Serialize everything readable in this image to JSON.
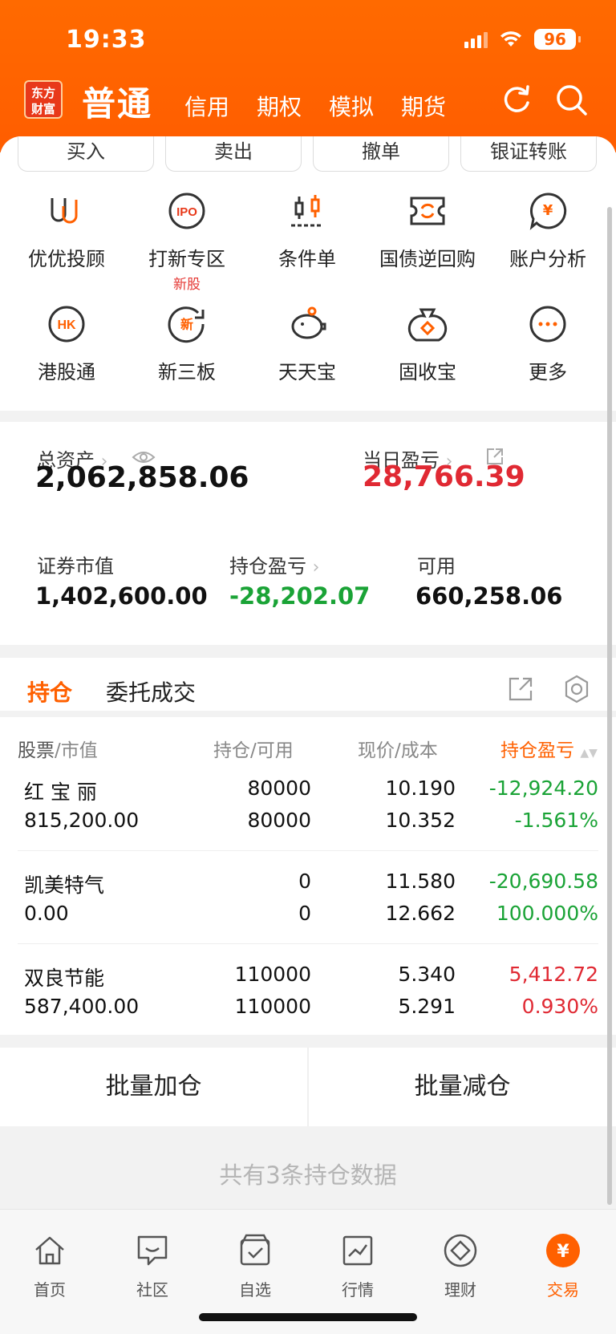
{
  "status": {
    "time": "19:33",
    "battery": "96"
  },
  "header": {
    "logo": "东方财富",
    "active_tab": "普通",
    "tabs": [
      "信用",
      "期权",
      "模拟",
      "期货"
    ]
  },
  "quick_buttons": [
    "买入",
    "卖出",
    "撤单",
    "银证转账"
  ],
  "functions": [
    {
      "label": "优优投顾",
      "icon": "uu-advisor-icon"
    },
    {
      "label": "打新专区",
      "sub": "新股",
      "icon": "ipo-icon"
    },
    {
      "label": "条件单",
      "icon": "conditional-order-icon"
    },
    {
      "label": "国债逆回购",
      "icon": "reverse-repo-icon"
    },
    {
      "label": "账户分析",
      "icon": "account-analysis-icon"
    },
    {
      "label": "港股通",
      "icon": "hk-connect-icon"
    },
    {
      "label": "新三板",
      "icon": "neeq-icon"
    },
    {
      "label": "天天宝",
      "icon": "piggy-bank-icon"
    },
    {
      "label": "固收宝",
      "icon": "money-bag-icon"
    },
    {
      "label": "更多",
      "icon": "more-icon"
    }
  ],
  "assets": {
    "total_label": "总资产",
    "total_value": "2,062,858.06",
    "daily_label": "当日盈亏",
    "daily_value": "28,766.39",
    "market_label": "证券市值",
    "market_value": "1,402,600.00",
    "position_pl_label": "持仓盈亏",
    "position_pl_value": "-28,202.07",
    "available_label": "可用",
    "available_value": "660,258.06"
  },
  "holdings": {
    "tab_active": "持仓",
    "tab_other": "委托成交",
    "headers": {
      "stock": "股票",
      "value": "市值",
      "position": "持仓",
      "available": "可用",
      "price": "现价",
      "cost": "成本",
      "pl": "持仓盈亏"
    },
    "rows": [
      {
        "name": "红 宝 丽",
        "value": "815,200.00",
        "position": "80000",
        "available": "80000",
        "price": "10.190",
        "cost": "10.352",
        "pl": "-12,924.20",
        "pl_pct": "-1.561%",
        "color": "#1aa336"
      },
      {
        "name": "凯美特气",
        "value": "0.00",
        "position": "0",
        "available": "0",
        "price": "11.580",
        "cost": "12.662",
        "pl": "-20,690.58",
        "pl_pct": "100.000%",
        "color": "#1aa336"
      },
      {
        "name": "双良节能",
        "value": "587,400.00",
        "position": "110000",
        "available": "110000",
        "price": "5.340",
        "cost": "5.291",
        "pl": "5,412.72",
        "pl_pct": "0.930%",
        "color": "#e02933"
      }
    ]
  },
  "batch": {
    "add": "批量加仓",
    "reduce": "批量减仓"
  },
  "footnote": "共有3条持仓数据",
  "tabbar": [
    {
      "label": "首页",
      "icon": "home-icon"
    },
    {
      "label": "社区",
      "icon": "community-icon"
    },
    {
      "label": "自选",
      "icon": "watchlist-icon"
    },
    {
      "label": "行情",
      "icon": "market-icon"
    },
    {
      "label": "理财",
      "icon": "wealth-icon"
    },
    {
      "label": "交易",
      "icon": "trade-icon"
    }
  ],
  "colors": {
    "brand": "#ff6000",
    "up": "#e02933",
    "down": "#1aa336"
  }
}
